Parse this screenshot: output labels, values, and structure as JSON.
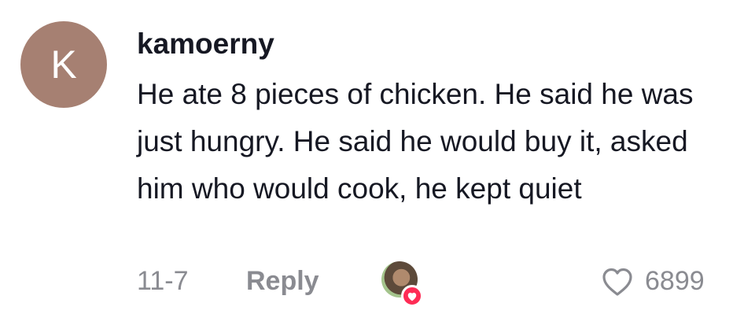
{
  "comment": {
    "avatar_letter": "K",
    "avatar_color": "#a68072",
    "username": "kamoerny",
    "text": "He ate 8 pieces of chicken. He said he was just hungry. He said he would buy it, asked him who would cook, he kept quiet",
    "date": "11-7",
    "reply_label": "Reply",
    "creator_liked_icon": "heart-icon",
    "like_icon": "heart-outline-icon",
    "like_count": "6899"
  },
  "colors": {
    "text_primary": "#161823",
    "text_secondary": "#8a8b91",
    "accent": "#fe2c55"
  }
}
